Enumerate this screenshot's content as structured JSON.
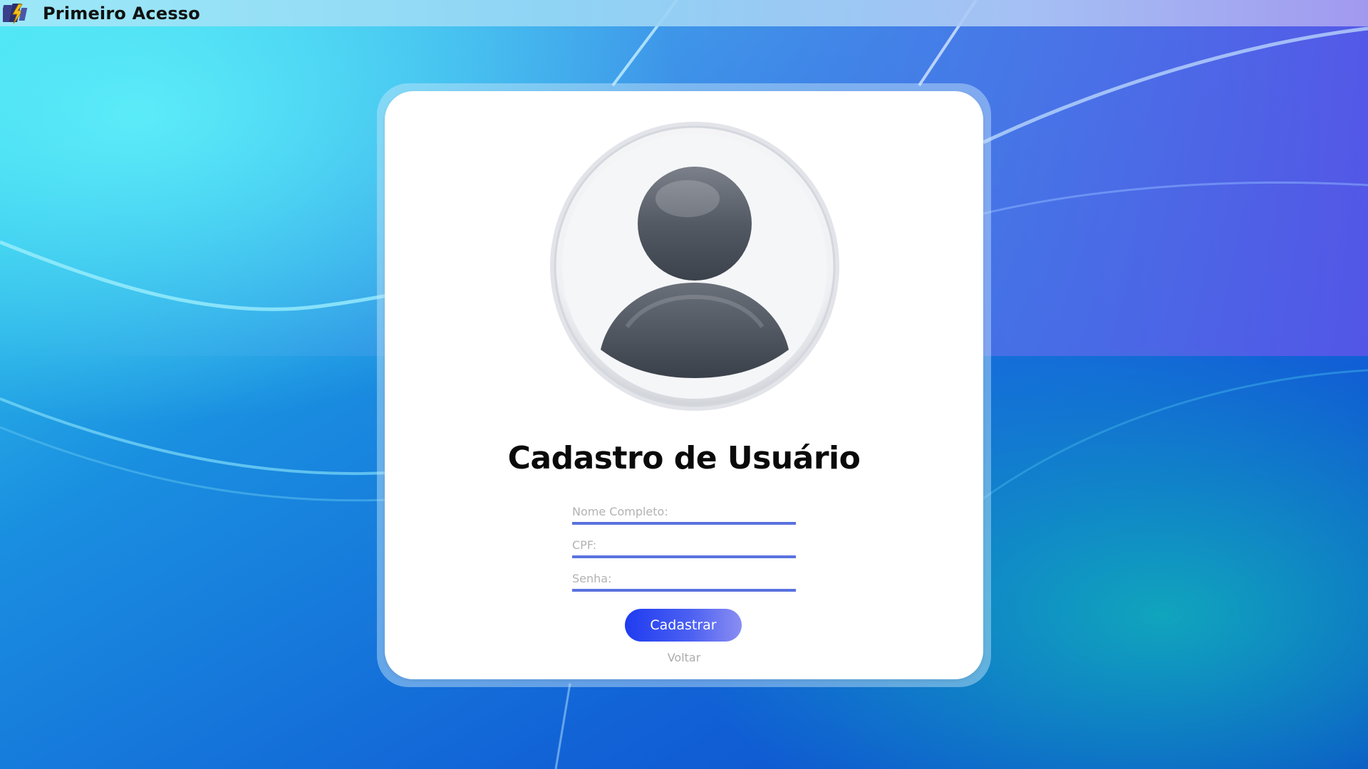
{
  "window": {
    "title": "Primeiro Acesso",
    "icon": "app-logo-icon"
  },
  "form": {
    "avatar_icon": "user-avatar-icon",
    "title": "Cadastro de Usuário",
    "fields": {
      "name_placeholder": "Nome Completo:",
      "cpf_placeholder": "CPF:",
      "password_placeholder": "Senha:"
    },
    "submit_label": "Cadastrar",
    "back_label": "Voltar"
  },
  "colors": {
    "accent": "#5a72e0",
    "button_start": "#1f3cf0",
    "button_end": "#8a8ef2",
    "placeholder": "#b2b2b2"
  }
}
